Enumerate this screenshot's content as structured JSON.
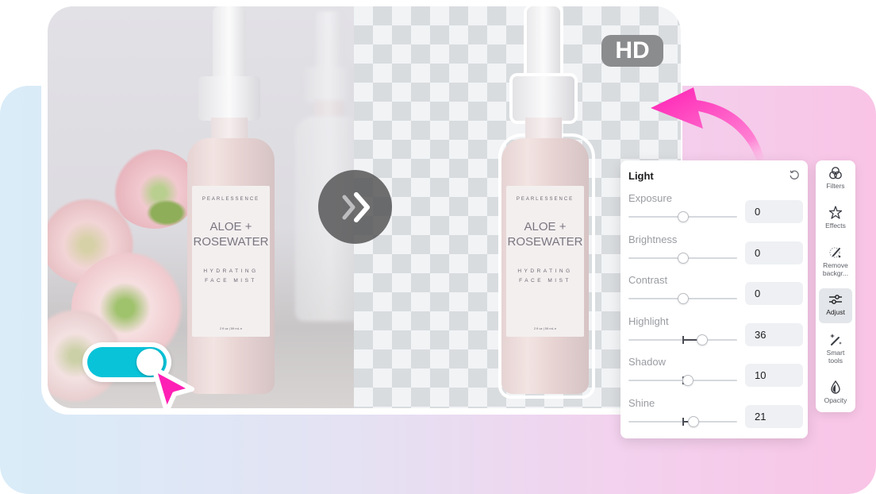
{
  "preview": {
    "before": {
      "brand": "PEARLESSENCE",
      "product_line1": "ALOE +",
      "product_line2": "ROSEWATER",
      "subtitle_line1": "HYDRATING",
      "subtitle_line2": "FACE MIST",
      "volume": "2 fl oz | 59 mL e"
    },
    "after": {
      "brand": "PEARLESSENCE",
      "product_line1": "ALOE +",
      "product_line2": "ROSEWATER",
      "subtitle_line1": "HYDRATING",
      "subtitle_line2": "FACE MIST",
      "volume": "2 fl oz | 59 mL e"
    },
    "badge": "HD",
    "compare_icon": "double-chevron-right-icon",
    "toggle_state": "on"
  },
  "colors": {
    "accent_pink": "#ff1fb4",
    "toggle_cyan": "#09c3d9"
  },
  "light_panel": {
    "title": "Light",
    "reset_icon": "reset-icon",
    "controls": [
      {
        "label": "Exposure",
        "value": "0",
        "position": 0.5,
        "origin": 0.5
      },
      {
        "label": "Brightness",
        "value": "0",
        "position": 0.5,
        "origin": 0.5
      },
      {
        "label": "Contrast",
        "value": "0",
        "position": 0.5,
        "origin": 0.5
      },
      {
        "label": "Highlight",
        "value": "36",
        "position": 0.68,
        "origin": 0.5
      },
      {
        "label": "Shadow",
        "value": "10",
        "position": 0.55,
        "origin": 0.5
      },
      {
        "label": "Shine",
        "value": "21",
        "position": 0.6,
        "origin": 0.5
      }
    ]
  },
  "sidebar": {
    "items": [
      {
        "label": "Filters",
        "icon": "filters-icon",
        "active": false
      },
      {
        "label": "Effects",
        "icon": "effects-icon",
        "active": false
      },
      {
        "label": "Remove backgr...",
        "icon": "remove-background-icon",
        "active": false
      },
      {
        "label": "Adjust",
        "icon": "adjust-icon",
        "active": true
      },
      {
        "label": "Smart tools",
        "icon": "smart-tools-icon",
        "active": false
      },
      {
        "label": "Opacity",
        "icon": "opacity-icon",
        "active": false
      }
    ]
  }
}
